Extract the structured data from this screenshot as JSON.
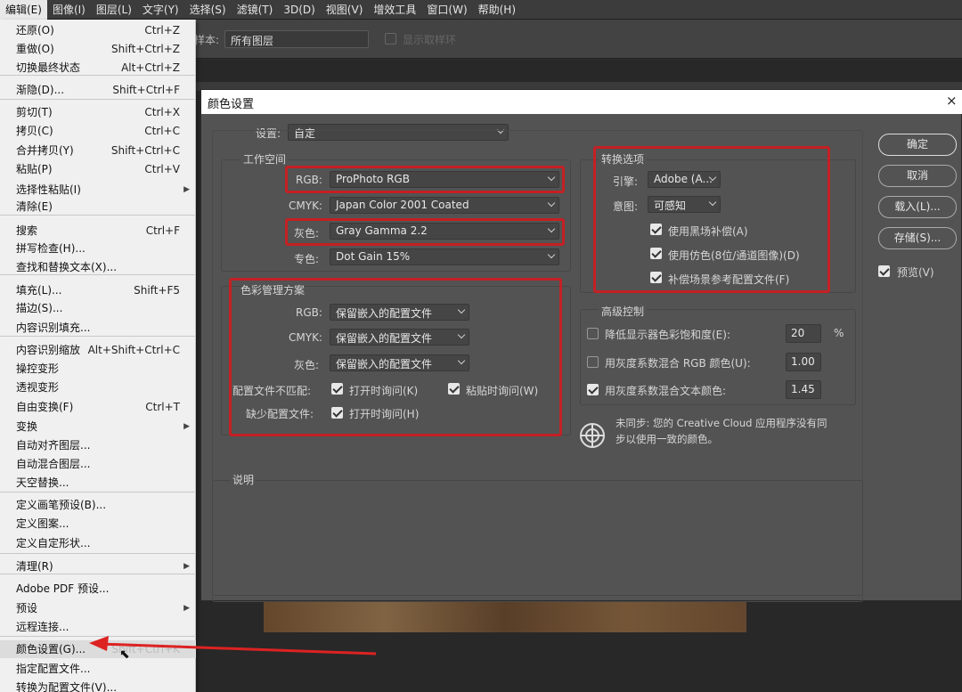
{
  "menubar": {
    "items": [
      "编辑(E)",
      "图像(I)",
      "图层(L)",
      "文字(Y)",
      "选择(S)",
      "滤镜(T)",
      "3D(D)",
      "视图(V)",
      "增效工具",
      "窗口(W)",
      "帮助(H)"
    ]
  },
  "optionsbar": {
    "sample_label": "样本:",
    "sample_value": "所有图层",
    "show_ring_label": "显示取样环"
  },
  "edit_menu": {
    "items": [
      {
        "label": "还原(O)",
        "shortcut": "Ctrl+Z"
      },
      {
        "label": "重做(O)",
        "shortcut": "Shift+Ctrl+Z"
      },
      {
        "label": "切换最终状态",
        "shortcut": "Alt+Ctrl+Z"
      },
      {
        "label": "渐隐(D)...",
        "shortcut": "Shift+Ctrl+F"
      },
      {
        "label": "剪切(T)",
        "shortcut": "Ctrl+X"
      },
      {
        "label": "拷贝(C)",
        "shortcut": "Ctrl+C"
      },
      {
        "label": "合并拷贝(Y)",
        "shortcut": "Shift+Ctrl+C"
      },
      {
        "label": "粘贴(P)",
        "shortcut": "Ctrl+V"
      },
      {
        "label": "选择性粘贴(I)",
        "shortcut": ""
      },
      {
        "label": "清除(E)",
        "shortcut": ""
      },
      {
        "label": "搜索",
        "shortcut": "Ctrl+F"
      },
      {
        "label": "拼写检查(H)...",
        "shortcut": ""
      },
      {
        "label": "查找和替换文本(X)...",
        "shortcut": ""
      },
      {
        "label": "填充(L)...",
        "shortcut": "Shift+F5"
      },
      {
        "label": "描边(S)...",
        "shortcut": ""
      },
      {
        "label": "内容识别填充...",
        "shortcut": ""
      },
      {
        "label": "内容识别缩放",
        "shortcut": "Alt+Shift+Ctrl+C"
      },
      {
        "label": "操控变形",
        "shortcut": ""
      },
      {
        "label": "透视变形",
        "shortcut": ""
      },
      {
        "label": "自由变换(F)",
        "shortcut": "Ctrl+T"
      },
      {
        "label": "变换",
        "shortcut": ""
      },
      {
        "label": "自动对齐图层...",
        "shortcut": ""
      },
      {
        "label": "自动混合图层...",
        "shortcut": ""
      },
      {
        "label": "天空替换...",
        "shortcut": ""
      },
      {
        "label": "定义画笔预设(B)...",
        "shortcut": ""
      },
      {
        "label": "定义图案...",
        "shortcut": ""
      },
      {
        "label": "定义自定形状...",
        "shortcut": ""
      },
      {
        "label": "清理(R)",
        "shortcut": ""
      },
      {
        "label": "Adobe PDF 预设...",
        "shortcut": ""
      },
      {
        "label": "预设",
        "shortcut": ""
      },
      {
        "label": "远程连接...",
        "shortcut": ""
      },
      {
        "label": "颜色设置(G)...",
        "shortcut": "Shift+Ctrl+K"
      },
      {
        "label": "指定配置文件...",
        "shortcut": ""
      },
      {
        "label": "转换为配置文件(V)...",
        "shortcut": ""
      }
    ]
  },
  "dialog": {
    "title": "颜色设置",
    "close": "×",
    "settings_label": "设置:",
    "settings_value": "自定",
    "workspace": {
      "title": "工作空间",
      "rgb_label": "RGB:",
      "rgb_value": "ProPhoto RGB",
      "cmyk_label": "CMYK:",
      "cmyk_value": "Japan Color 2001 Coated",
      "gray_label": "灰色:",
      "gray_value": "Gray Gamma 2.2",
      "spot_label": "专色:",
      "spot_value": "Dot Gain 15%"
    },
    "policy": {
      "title": "色彩管理方案",
      "rgb_label": "RGB:",
      "rgb_value": "保留嵌入的配置文件",
      "cmyk_label": "CMYK:",
      "cmyk_value": "保留嵌入的配置文件",
      "gray_label": "灰色:",
      "gray_value": "保留嵌入的配置文件",
      "mismatch_label": "配置文件不匹配:",
      "ask_open": "打开时询问(K)",
      "ask_paste": "粘贴时询问(W)",
      "missing_label": "缺少配置文件:",
      "missing_ask_open": "打开时询问(H)"
    },
    "conversion": {
      "title": "转换选项",
      "engine_label": "引擎:",
      "engine_value": "Adobe (A...",
      "intent_label": "意图:",
      "intent_value": "可感知",
      "bpc": "使用黑场补偿(A)",
      "dither": "使用仿色(8位/通道图像)(D)",
      "scene": "补偿场景参考配置文件(F)"
    },
    "advanced": {
      "title": "高级控制",
      "desaturate": "降低显示器色彩饱和度(E):",
      "desaturate_value": "20",
      "desaturate_unit": "%",
      "blend_rgb": "用灰度系数混合 RGB 颜色(U):",
      "blend_rgb_value": "1.00",
      "blend_text": "用灰度系数混合文本颜色:",
      "blend_text_value": "1.45"
    },
    "sync_message": "未同步: 您的 Creative Cloud 应用程序没有同步以使用一致的颜色。",
    "sync_line1": "未同步: 您的 Creative Cloud 应用程序没有同",
    "sync_line2": "步以使用一致的颜色。",
    "description_title": "说明",
    "buttons": {
      "ok": "确定",
      "cancel": "取消",
      "load": "载入(L)...",
      "save": "存储(S)..."
    },
    "preview_label": "预览(V)"
  },
  "colors": {
    "highlight_red": "#c42024",
    "dialog_bg": "#535353",
    "menu_bg": "#f0f0f0"
  }
}
